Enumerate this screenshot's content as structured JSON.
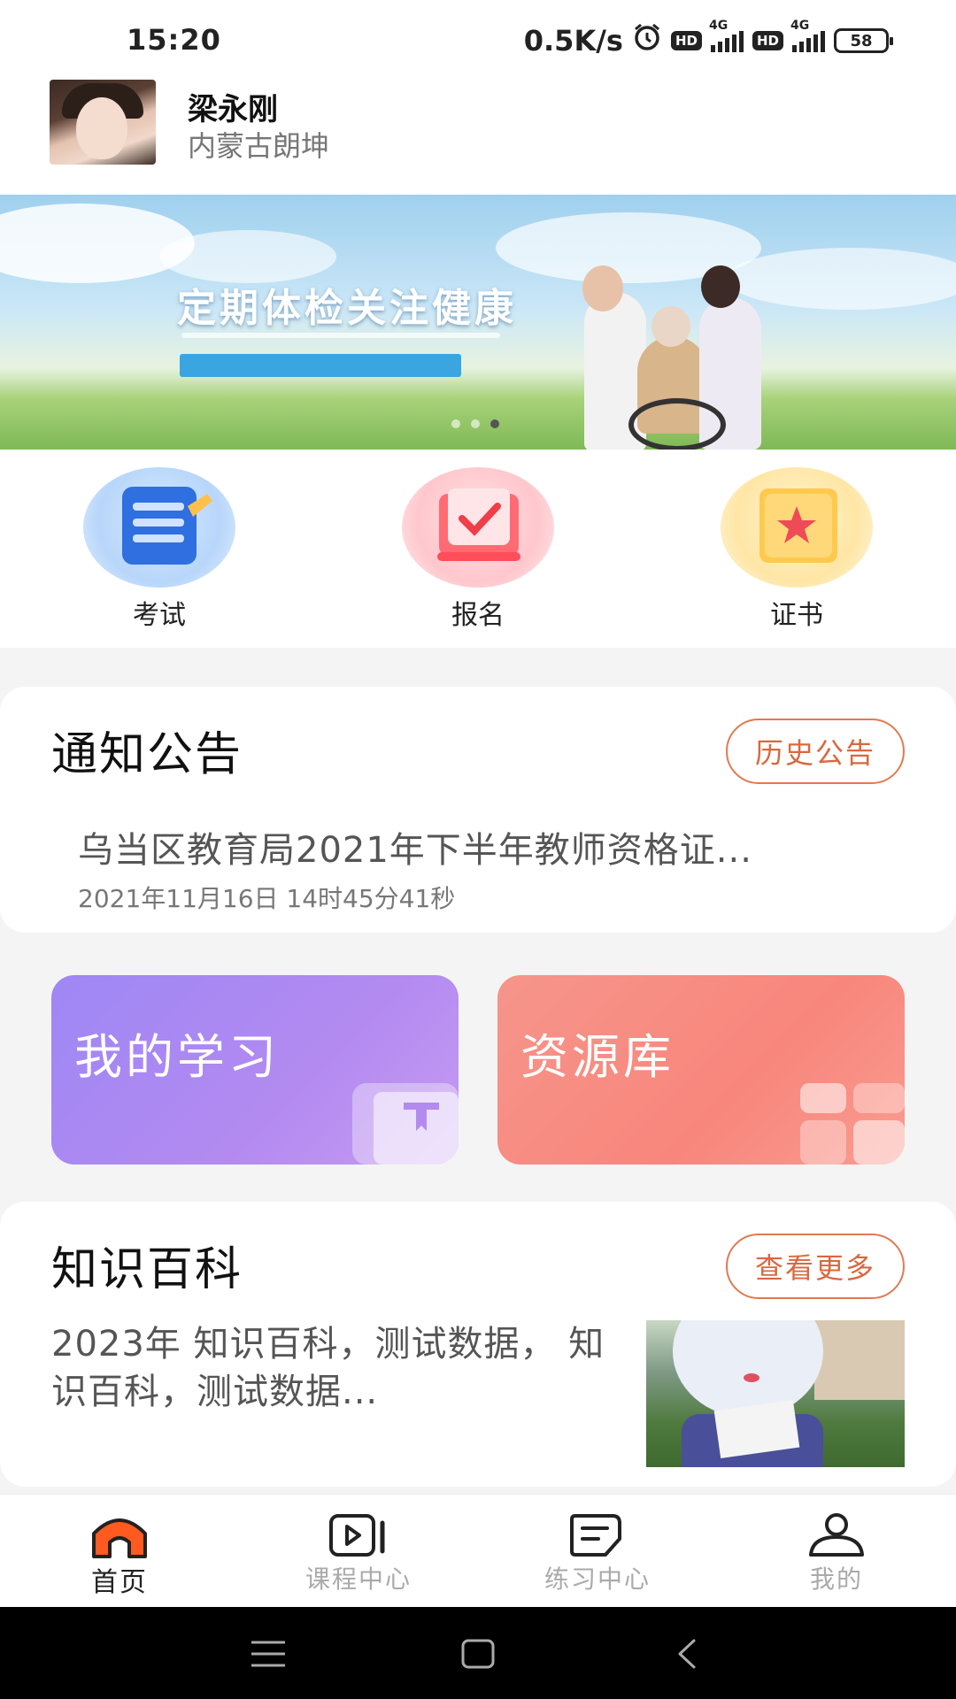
{
  "status_bar": {
    "time": "15:20",
    "net_speed": "0.5K/s",
    "hd_badge": "HD",
    "network_type": "4G",
    "battery": "58"
  },
  "profile": {
    "name": "梁永刚",
    "region": "内蒙古朗坤"
  },
  "banner": {
    "title": "定期体检关注健康",
    "slide_count": 3,
    "active_slide": 3
  },
  "quick_entries": [
    {
      "label": "考试",
      "icon": "exam-icon"
    },
    {
      "label": "报名",
      "icon": "register-icon"
    },
    {
      "label": "证书",
      "icon": "certificate-icon"
    }
  ],
  "notice": {
    "title": "通知公告",
    "history_label": "历史公告",
    "item_title": "乌当区教育局2021年下半年教师资格证...",
    "item_date": "2021年11月16日 14时45分41秒"
  },
  "tiles": {
    "study_label": "我的学习",
    "resource_label": "资源库"
  },
  "wiki": {
    "title": "知识百科",
    "more_label": "查看更多",
    "item_text": "2023年  知识百科，测试数据，  知识百科，测试数据..."
  },
  "tabbar": {
    "items": [
      {
        "label": "首页",
        "icon": "home-icon",
        "active": true
      },
      {
        "label": "课程中心",
        "icon": "video-icon",
        "active": false
      },
      {
        "label": "练习中心",
        "icon": "practice-icon",
        "active": false
      },
      {
        "label": "我的",
        "icon": "user-icon",
        "active": false
      }
    ]
  },
  "colors": {
    "accent": "#d8683f",
    "study_tile": "#b38af0",
    "resource_tile": "#f8867d",
    "active_tab": "#ff5a1f"
  }
}
